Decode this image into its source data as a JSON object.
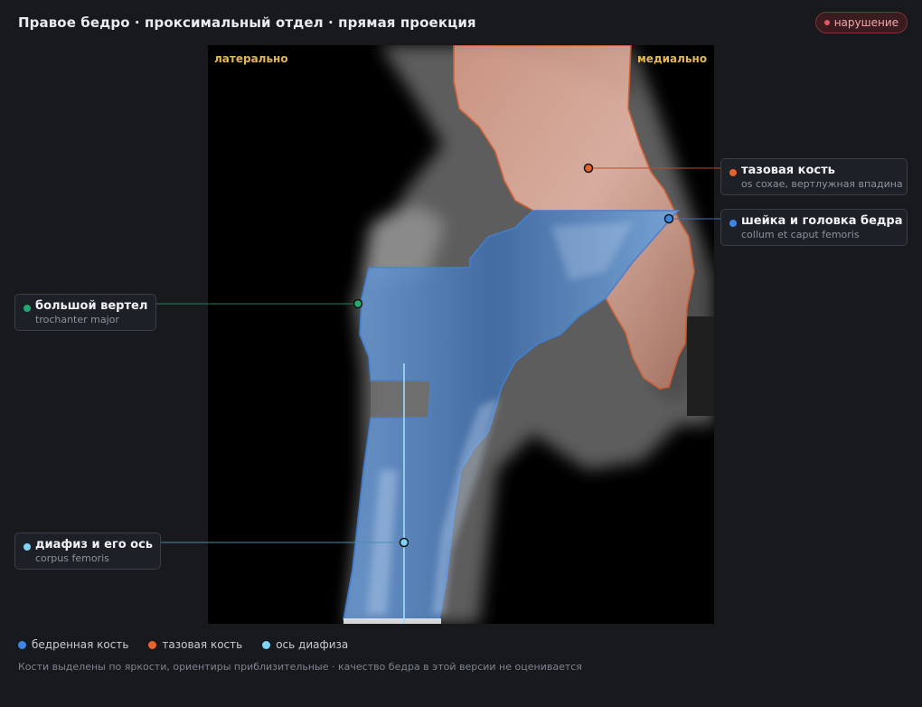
{
  "header": {
    "title": "Правое бедро · проксимальный отдел · прямая проекция",
    "badge": "нарушение"
  },
  "orientation": {
    "left": "латерально",
    "right": "медиально"
  },
  "labels": [
    {
      "id": "pelvis",
      "name": "тазовая кость",
      "latin": "os coxae, вертлужная впадина",
      "color": "#e8622f"
    },
    {
      "id": "neck",
      "name": "шейка и головка бедра",
      "latin": "collum et caput femoris",
      "color": "#3d86e6"
    },
    {
      "id": "trochanter",
      "name": "большой вертел",
      "latin": "trochanter major",
      "color": "#23a872"
    },
    {
      "id": "shaft",
      "name": "диафиз и его ось",
      "latin": "corpus femoris",
      "color": "#7fd3f5"
    }
  ],
  "legend": [
    {
      "label": "бедренная кость",
      "color": "#3d86e6"
    },
    {
      "label": "тазовая кость",
      "color": "#e8622f"
    },
    {
      "label": "ось диафиза",
      "color": "#7fd3f5"
    }
  ],
  "footnote": "Кости выделены по яркости, ориентиры приблизительные · качество бедра в этой версии не оценивается",
  "colors": {
    "femur": "#3d86e6",
    "pelvis": "#e8622f",
    "axis": "#7fd3f5",
    "alert": "#e05a63",
    "orientation": "#e4b84f"
  }
}
